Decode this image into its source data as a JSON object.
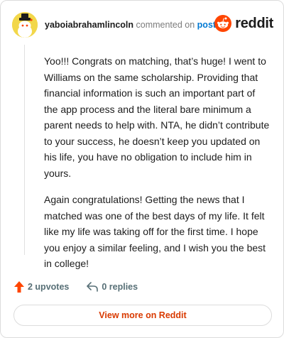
{
  "header": {
    "username": "yaboiabrahamlincoln",
    "verb": " commented on ",
    "link": "post",
    "brand": "reddit",
    "avatar_icon": "snoo-avatar-icon",
    "brand_icon": "reddit-logo-icon"
  },
  "comment": {
    "paragraphs": [
      "Yoo!!! Congrats on matching, that’s huge! I went to Williams on the same scholarship. Providing that financial information is such an important part of the app process and the literal bare minimum a parent needs to help with. NTA, he didn’t contribute to your success, he doesn’t keep you updated on his life, you have no obligation to include him in yours.",
      "Again congratulations! Getting the news that I matched was one of the best days of my life. It felt like my life was taking off for the first time. I hope you enjoy a similar feeling, and I wish you the best in college!"
    ]
  },
  "actions": {
    "upvotes": "2 upvotes",
    "replies": "0 replies",
    "upvote_icon": "upvote-arrow-icon",
    "reply_icon": "reply-arrow-icon"
  },
  "footer": {
    "view_more": "View more on Reddit"
  },
  "colors": {
    "accent": "#d93a00",
    "reddit_orange": "#ff4500",
    "link": "#0079d3",
    "avatar_bg": "#f2d74a"
  }
}
